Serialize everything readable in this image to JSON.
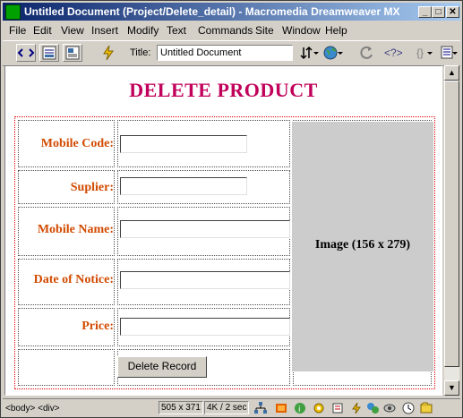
{
  "window": {
    "title": "Untitled Document (Project/Delete_detail) - Macromedia Dreamweaver MX",
    "minimize_icon": "minimize-icon",
    "maximize_icon": "maximize-icon",
    "close_icon": "close-icon"
  },
  "menu": [
    "File",
    "Edit",
    "View",
    "Insert",
    "Modify",
    "Text",
    "Commands",
    "Site",
    "Window",
    "Help"
  ],
  "toolbar": {
    "title_label": "Title:",
    "title_value": "Untitled Document"
  },
  "page": {
    "heading": "DELETE PRODUCT",
    "labels": {
      "mobile_code": "Mobile Code:",
      "suplier": "Suplier:",
      "mobile_name": "Mobile Name:",
      "date_of_notice": "Date of Notice:",
      "price": "Price:"
    },
    "fields": {
      "mobile_code": "",
      "suplier": "",
      "mobile_name": "",
      "date_of_notice": "",
      "price": ""
    },
    "image_placeholder": "Image (156 x 279)",
    "delete_button": "Delete Record"
  },
  "status": {
    "tag_selector": "<body> <div>",
    "window_size": "505 x 371",
    "download": "4K / 2 sec"
  },
  "colors": {
    "heading": "#c0005a",
    "label": "#d24a00",
    "table_border": "#e00000",
    "titlebar_start": "#0a246a",
    "titlebar_end": "#a6caf0"
  }
}
